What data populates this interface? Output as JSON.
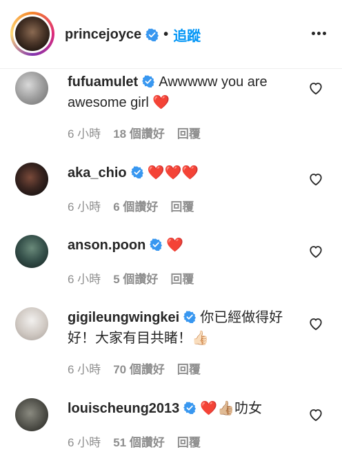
{
  "header": {
    "username": "princejoyce",
    "separator": "•",
    "follow_label": "追蹤",
    "more_icon": "more-horizontal-icon"
  },
  "comments": [
    {
      "username": "fufuamulet",
      "text": "Awwwww you are awesome girl ❤️",
      "time": "6 小時",
      "likes": "18 個讚好",
      "reply": "回覆"
    },
    {
      "username": "aka_chio",
      "text": "❤️❤️❤️",
      "time": "6 小時",
      "likes": "6 個讚好",
      "reply": "回覆"
    },
    {
      "username": "anson.poon",
      "text": "❤️",
      "time": "6 小時",
      "likes": "5 個讚好",
      "reply": "回覆"
    },
    {
      "username": "gigileungwingkei",
      "text": "你已經做得好好！大家有目共睹！👍🏻",
      "time": "6 小時",
      "likes": "70 個讚好",
      "reply": "回覆"
    },
    {
      "username": "louischeung2013",
      "text": "❤️👍🏼叻女",
      "time": "6 小時",
      "likes": "51 個讚好",
      "reply": "回覆"
    }
  ],
  "colors": {
    "text": "#262626",
    "meta": "#8e8e8e",
    "link": "#0095f6",
    "verified": "#3897f0",
    "heart": "#ed4956"
  }
}
